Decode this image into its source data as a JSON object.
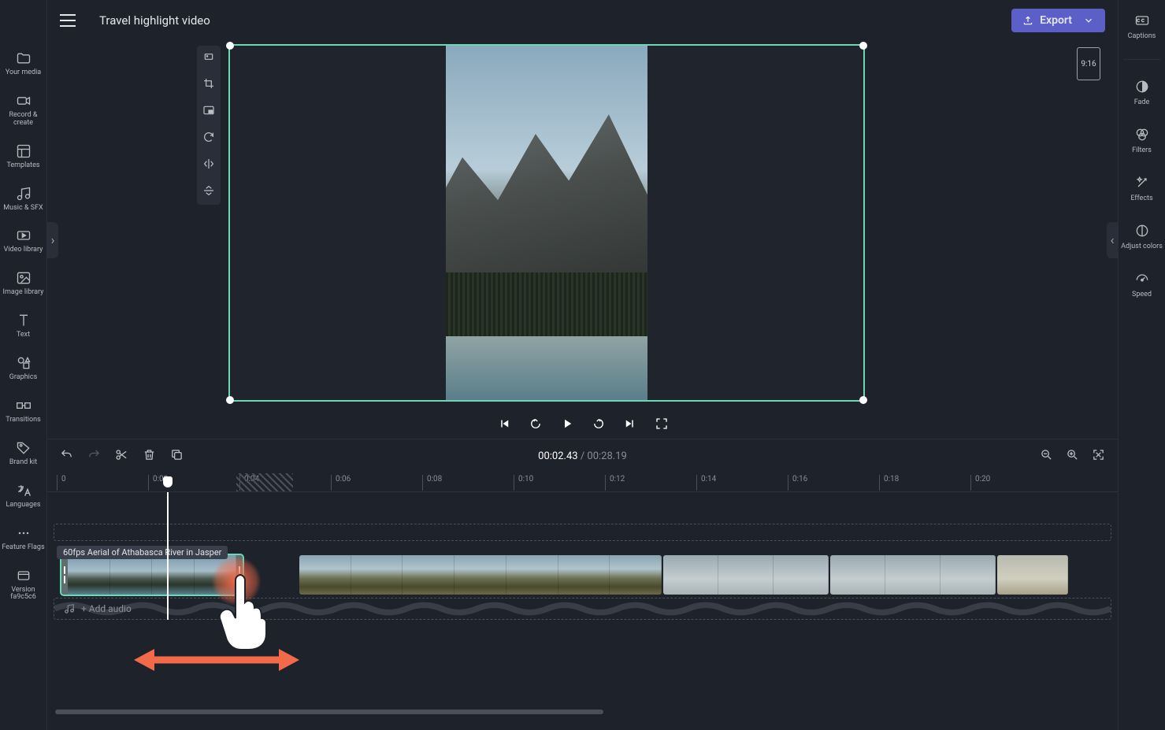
{
  "header": {
    "title": "Travel highlight video",
    "export_label": "Export"
  },
  "left_nav": {
    "items": [
      {
        "label": "Your media"
      },
      {
        "label": "Record & create"
      },
      {
        "label": "Templates"
      },
      {
        "label": "Music & SFX"
      },
      {
        "label": "Video library"
      },
      {
        "label": "Image library"
      },
      {
        "label": "Text"
      },
      {
        "label": "Graphics"
      },
      {
        "label": "Transitions"
      },
      {
        "label": "Brand kit"
      },
      {
        "label": "Languages"
      },
      {
        "label": "Feature Flags"
      },
      {
        "label": "Version fa9c5c6"
      }
    ]
  },
  "right_nav": {
    "items": [
      {
        "label": "Captions"
      },
      {
        "label": "Fade"
      },
      {
        "label": "Filters"
      },
      {
        "label": "Effects"
      },
      {
        "label": "Adjust colors"
      },
      {
        "label": "Speed"
      }
    ]
  },
  "preview": {
    "aspect_label": "9:16"
  },
  "timeline": {
    "current_time": "00:02.43",
    "total_time": "00:28.19",
    "ruler_marks": [
      "0",
      "0:02",
      "0:04",
      "0:06",
      "0:08",
      "0:10",
      "0:12",
      "0:14",
      "0:16",
      "0:18",
      "0:20"
    ],
    "clip_tooltip": "60fps Aerial of Athabasca River in Jasper",
    "add_audio_label": "+ Add audio"
  }
}
